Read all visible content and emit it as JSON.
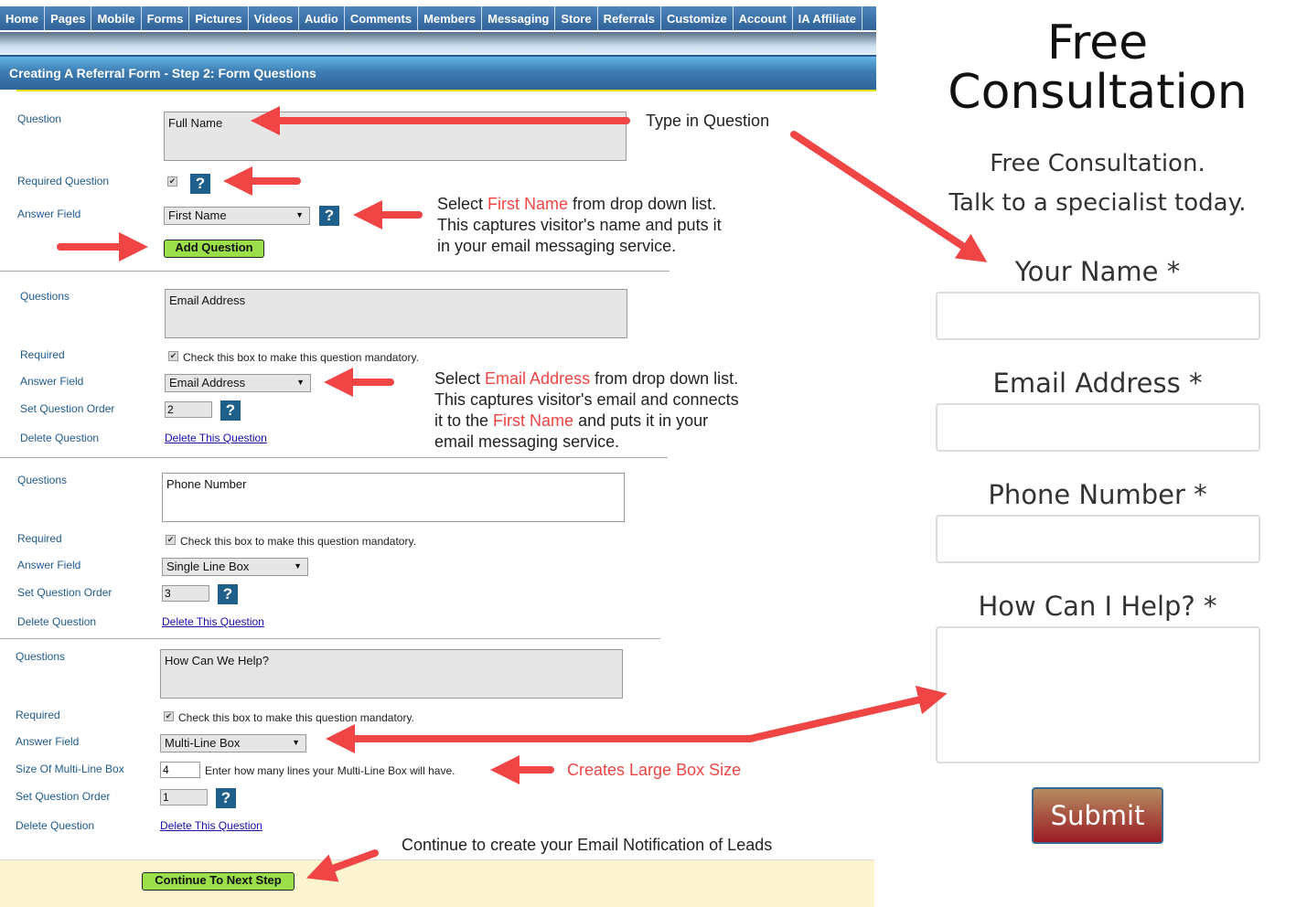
{
  "nav": [
    "Home",
    "Pages",
    "Mobile",
    "Forms",
    "Pictures",
    "Videos",
    "Audio",
    "Comments",
    "Members",
    "Messaging",
    "Store",
    "Referrals",
    "Customize",
    "Account",
    "IA Affiliate"
  ],
  "header": "Creating A Referral Form - Step 2: Form Questions",
  "q1": {
    "label_question": "Question",
    "question": "Full Name",
    "label_required": "Required Question",
    "label_answer": "Answer Field",
    "answer": "First Name",
    "add": "Add Question",
    "help": "?"
  },
  "q2": {
    "label_question": "Questions",
    "question": "Email Address",
    "label_required": "Required",
    "required_text": "Check this box to make this question mandatory.",
    "label_answer": "Answer Field",
    "answer": "Email Address",
    "label_order": "Set Question Order",
    "order": "2",
    "label_delete": "Delete Question",
    "delete": "Delete This Question"
  },
  "q3": {
    "label_question": "Questions",
    "question": "Phone Number",
    "label_required": "Required",
    "required_text": "Check this box to make this question mandatory.",
    "label_answer": "Answer Field",
    "answer": "Single Line Box",
    "label_order": "Set Question Order",
    "order": "3",
    "label_delete": "Delete Question",
    "delete": "Delete This Question"
  },
  "q4": {
    "label_question": "Questions",
    "question": "How Can We Help?",
    "label_required": "Required",
    "required_text": "Check this box to make this question mandatory.",
    "label_answer": "Answer Field",
    "answer": "Multi-Line Box",
    "label_size": "Size Of Multi-Line Box",
    "size": "4",
    "size_text": "Enter how many lines your Multi-Line Box will have.",
    "label_order": "Set Question Order",
    "order": "1",
    "label_delete": "Delete Question",
    "delete": "Delete This Question"
  },
  "continue": "Continue To Next Step",
  "annotations": {
    "type_q": "Type in Question",
    "a1_pre": "Select ",
    "a1_hl": "First Name",
    "a1_post": " from drop down list.",
    "a1_l2": "This captures visitor's name and puts it",
    "a1_l3": "in your email messaging service.",
    "a2_pre": "Select ",
    "a2_hl": "Email Address",
    "a2_post": " from drop down list.",
    "a2_l2": "This captures visitor's email and connects",
    "a2_l3_pre": "it to the ",
    "a2_l3_hl": "First Name",
    "a2_l3_post": " and puts it in your",
    "a2_l4": "email messaging service.",
    "large": "Creates Large Box Size",
    "continue_note": "Continue to create your Email Notification of Leads"
  },
  "preview": {
    "title_l1": "Free",
    "title_l2": "Consultation",
    "sub1": "Free Consultation.",
    "sub2": "Talk to a specialist today.",
    "fields": [
      "Your Name",
      "Email Address",
      "Phone Number",
      "How Can I Help?"
    ],
    "required_mark": "*",
    "submit": "Submit"
  },
  "colors": {
    "nav": "#3a6ea5",
    "accent_red": "#f04545",
    "green_button": "#9be04a",
    "help": "#1f5f8b",
    "submit": "#9b1b24"
  }
}
